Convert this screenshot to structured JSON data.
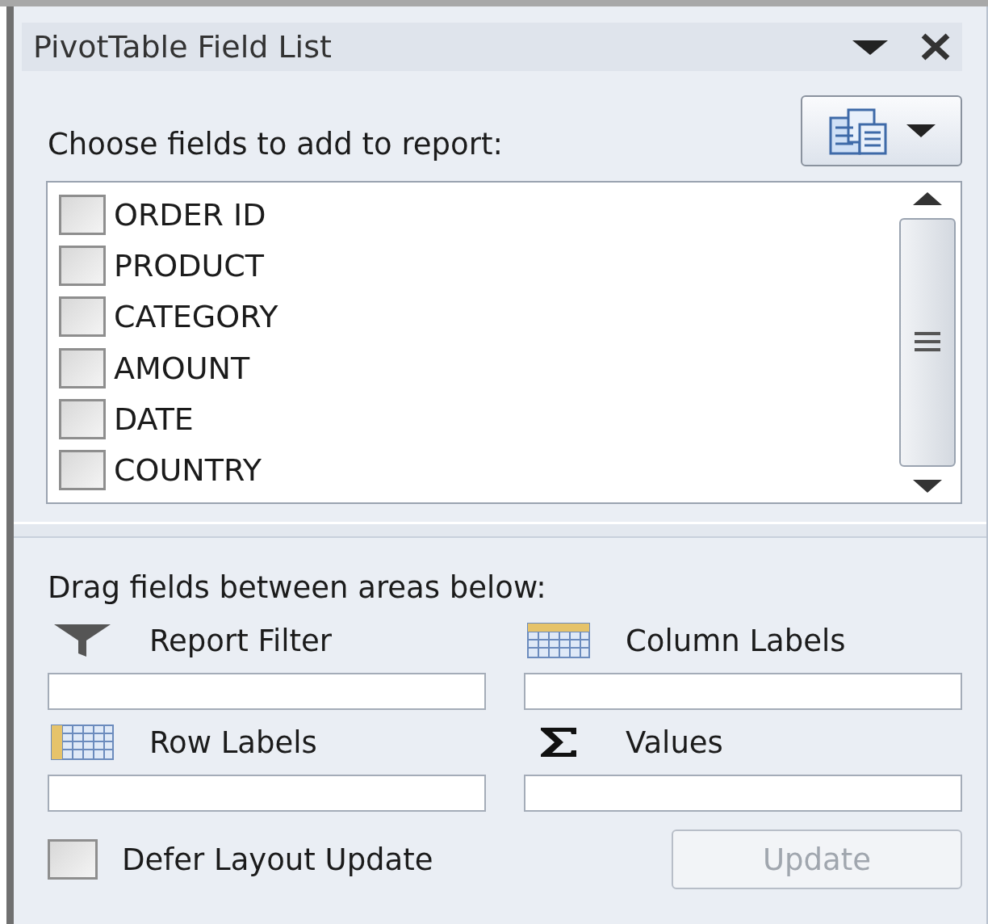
{
  "title": "PivotTable Field List",
  "choose_label": "Choose fields to add to report:",
  "fields": [
    {
      "label": "ORDER ID",
      "checked": false
    },
    {
      "label": "PRODUCT",
      "checked": false
    },
    {
      "label": "CATEGORY",
      "checked": false
    },
    {
      "label": "AMOUNT",
      "checked": false
    },
    {
      "label": "DATE",
      "checked": false
    },
    {
      "label": "COUNTRY",
      "checked": false
    }
  ],
  "drag_label": "Drag fields between areas below:",
  "areas": [
    {
      "kind": "filter",
      "label": "Report Filter"
    },
    {
      "kind": "columns",
      "label": "Column Labels"
    },
    {
      "kind": "rows",
      "label": "Row Labels"
    },
    {
      "kind": "values",
      "label": "Values"
    }
  ],
  "defer": {
    "label": "Defer Layout Update",
    "checked": false
  },
  "update_button": {
    "label": "Update",
    "disabled": true
  }
}
